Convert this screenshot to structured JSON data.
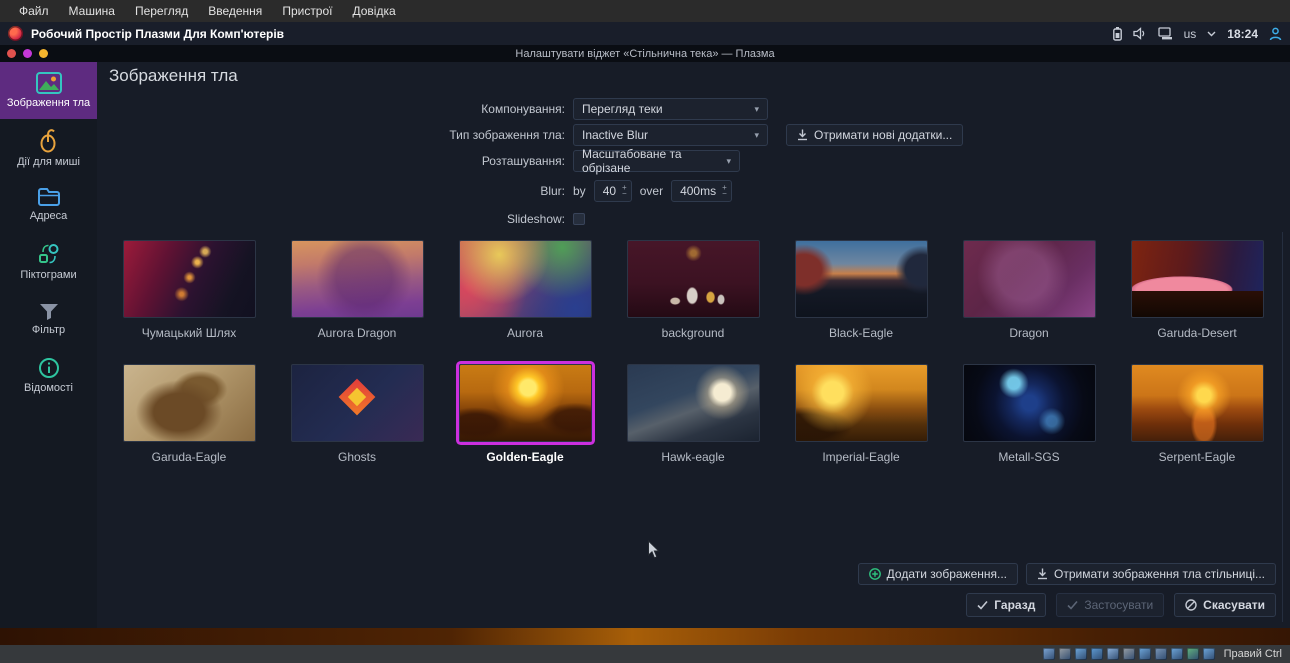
{
  "host_menubar": {
    "items": [
      "Файл",
      "Машина",
      "Перегляд",
      "Введення",
      "Пристрої",
      "Довідка"
    ]
  },
  "panel": {
    "title": "Робочий Простір Плазми Для Комп'ютерів",
    "tray": {
      "keyboard_layout": "us",
      "time": "18:24"
    }
  },
  "window": {
    "title": "Налаштувати віджет «Стільнична тека» — Плазма",
    "controls": [
      "close-dot",
      "minimize-dot",
      "maximize-dot"
    ]
  },
  "sidebar": {
    "items": [
      {
        "label": "Зображення тла",
        "icon": "wallpaper-icon",
        "selected": true
      },
      {
        "label": "Дії для миші",
        "icon": "mouse-icon",
        "selected": false
      },
      {
        "label": "Адреса",
        "icon": "folder-icon",
        "selected": false
      },
      {
        "label": "Піктограми",
        "icon": "icons-icon",
        "selected": false
      },
      {
        "label": "Фільтр",
        "icon": "filter-icon",
        "selected": false
      },
      {
        "label": "Відомості",
        "icon": "info-icon",
        "selected": false
      }
    ]
  },
  "main": {
    "heading": "Зображення тла",
    "form": {
      "layout_label": "Компонування:",
      "layout_value": "Перегляд теки",
      "wallpaper_type_label": "Тип зображення тла:",
      "wallpaper_type_value": "Inactive Blur",
      "get_new_plugins_button": "Отримати нові додатки...",
      "positioning_label": "Розташування:",
      "positioning_value": "Масштабоване та обрізане",
      "blur_label": "Blur:",
      "blur_by_label": "by",
      "blur_by_value": "40",
      "blur_over_label": "over",
      "blur_over_value": "400ms",
      "slideshow_label": "Slideshow:",
      "slideshow_checked": false
    },
    "gallery": {
      "items": [
        {
          "label": "Чумацький Шлях",
          "style": "milky-way",
          "selected": false
        },
        {
          "label": "Aurora Dragon",
          "style": "aurora-dragon",
          "selected": false
        },
        {
          "label": "Aurora",
          "style": "aurora",
          "selected": false
        },
        {
          "label": "background",
          "style": "background",
          "selected": false
        },
        {
          "label": "Black-Eagle",
          "style": "black-eagle",
          "selected": false
        },
        {
          "label": "Dragon",
          "style": "dragon",
          "selected": false
        },
        {
          "label": "Garuda-Desert",
          "style": "garuda-desert",
          "selected": false
        },
        {
          "label": "Garuda-Eagle",
          "style": "garuda-eagle",
          "selected": false
        },
        {
          "label": "Ghosts",
          "style": "ghosts",
          "selected": false
        },
        {
          "label": "Golden-Eagle",
          "style": "golden-eagle",
          "selected": true
        },
        {
          "label": "Hawk-eagle",
          "style": "hawk-eagle",
          "selected": false
        },
        {
          "label": "Imperial-Eagle",
          "style": "imperial-eagle",
          "selected": false
        },
        {
          "label": "Metall-SGS",
          "style": "metall-sgs",
          "selected": false
        },
        {
          "label": "Serpent-Eagle",
          "style": "serpent-eagle",
          "selected": false
        }
      ]
    },
    "actions": {
      "add_image": "Додати зображення...",
      "get_wallpapers": "Отримати зображення тла стільниці..."
    },
    "dialog_buttons": {
      "ok": "Гаразд",
      "apply": "Застосувати",
      "cancel": "Скасувати"
    }
  },
  "statusbar": {
    "icons": [
      "hdd-icon",
      "optical-disc-icon",
      "audio-icon",
      "network-icon",
      "usb-icon",
      "shared-folders-icon",
      "display-icon",
      "recording-icon",
      "features-icon",
      "mouse-integration-icon",
      "keyboard-icon"
    ],
    "host_key_label": "Правий Ctrl"
  },
  "colors": {
    "accent_purple": "#5e2b80",
    "selection_magenta": "#cc2fdf",
    "dot_red": "#e0524e",
    "dot_magenta": "#c538d8",
    "dot_yellow": "#f5b52e",
    "panel_bg": "#191e2a",
    "window_bg": "#171c27"
  }
}
